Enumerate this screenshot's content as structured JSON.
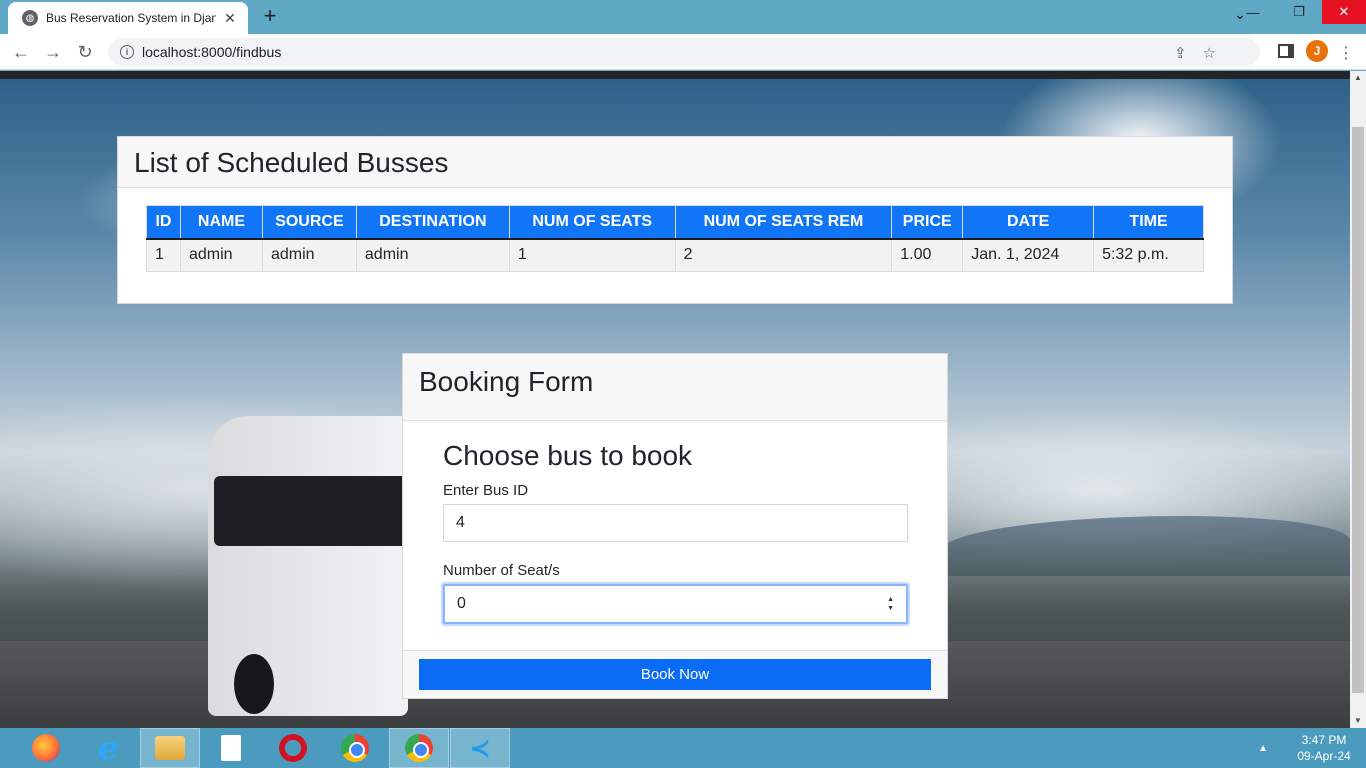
{
  "browser": {
    "tab_title": "Bus Reservation System in Django",
    "url": "localhost:8000/findbus",
    "profile_initial": "J"
  },
  "list_card": {
    "title": "List of Scheduled Busses",
    "columns": [
      "ID",
      "NAME",
      "SOURCE",
      "DESTINATION",
      "NUM OF SEATS",
      "NUM OF SEATS REM",
      "PRICE",
      "DATE",
      "TIME"
    ],
    "rows": [
      [
        "1",
        "admin",
        "admin",
        "admin",
        "1",
        "2",
        "1.00",
        "Jan. 1, 2024",
        "5:32 p.m."
      ]
    ]
  },
  "booking_card": {
    "title": "Booking Form",
    "subtitle": "Choose bus to book",
    "bus_id_label": "Enter Bus ID",
    "bus_id_value": "4",
    "seats_label": "Number of Seat/s",
    "seats_value": "0",
    "submit_label": "Book Now"
  },
  "taskbar": {
    "apps": [
      "firefox-icon",
      "internet-explorer-icon",
      "file-explorer-icon",
      "file-icon",
      "opera-icon",
      "chrome-icon",
      "chrome-active-icon",
      "vscode-icon"
    ],
    "time": "3:47 PM",
    "date": "09-Apr-24"
  },
  "colors": {
    "primary": "#0a6cf5",
    "table_header": "#1075f6",
    "taskbar": "#4a9bbd"
  }
}
